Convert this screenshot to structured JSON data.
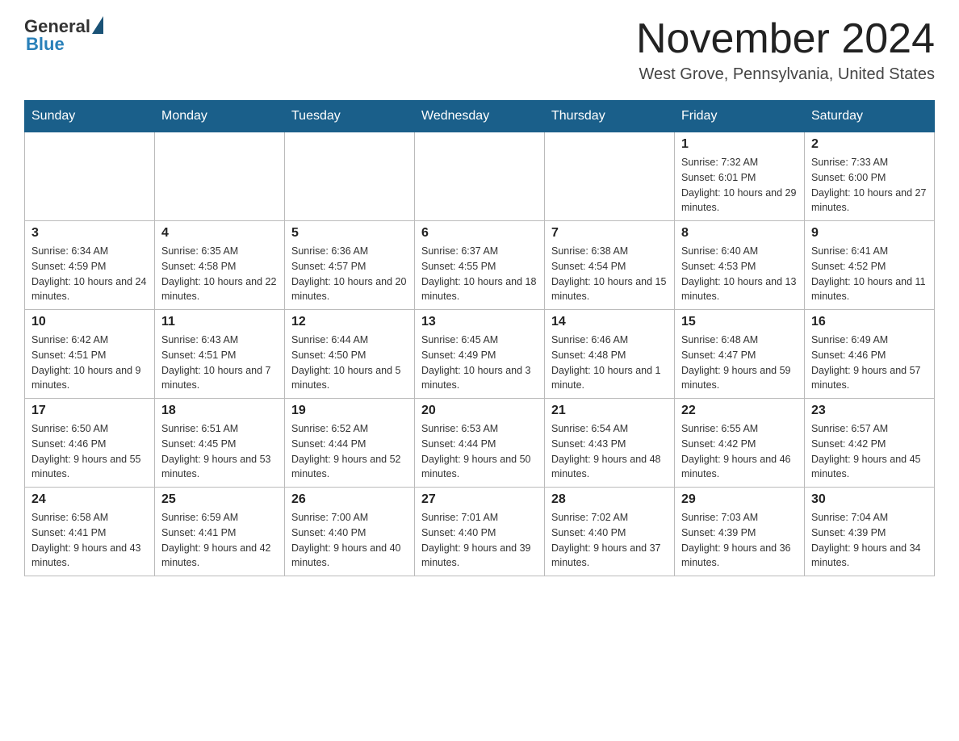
{
  "header": {
    "logo_general": "General",
    "logo_blue": "Blue",
    "month_title": "November 2024",
    "location": "West Grove, Pennsylvania, United States"
  },
  "weekdays": [
    "Sunday",
    "Monday",
    "Tuesday",
    "Wednesday",
    "Thursday",
    "Friday",
    "Saturday"
  ],
  "rows": [
    {
      "cells": [
        {
          "day": null,
          "sunrise": null,
          "sunset": null,
          "daylight": null
        },
        {
          "day": null,
          "sunrise": null,
          "sunset": null,
          "daylight": null
        },
        {
          "day": null,
          "sunrise": null,
          "sunset": null,
          "daylight": null
        },
        {
          "day": null,
          "sunrise": null,
          "sunset": null,
          "daylight": null
        },
        {
          "day": null,
          "sunrise": null,
          "sunset": null,
          "daylight": null
        },
        {
          "day": "1",
          "sunrise": "Sunrise: 7:32 AM",
          "sunset": "Sunset: 6:01 PM",
          "daylight": "Daylight: 10 hours and 29 minutes."
        },
        {
          "day": "2",
          "sunrise": "Sunrise: 7:33 AM",
          "sunset": "Sunset: 6:00 PM",
          "daylight": "Daylight: 10 hours and 27 minutes."
        }
      ]
    },
    {
      "cells": [
        {
          "day": "3",
          "sunrise": "Sunrise: 6:34 AM",
          "sunset": "Sunset: 4:59 PM",
          "daylight": "Daylight: 10 hours and 24 minutes."
        },
        {
          "day": "4",
          "sunrise": "Sunrise: 6:35 AM",
          "sunset": "Sunset: 4:58 PM",
          "daylight": "Daylight: 10 hours and 22 minutes."
        },
        {
          "day": "5",
          "sunrise": "Sunrise: 6:36 AM",
          "sunset": "Sunset: 4:57 PM",
          "daylight": "Daylight: 10 hours and 20 minutes."
        },
        {
          "day": "6",
          "sunrise": "Sunrise: 6:37 AM",
          "sunset": "Sunset: 4:55 PM",
          "daylight": "Daylight: 10 hours and 18 minutes."
        },
        {
          "day": "7",
          "sunrise": "Sunrise: 6:38 AM",
          "sunset": "Sunset: 4:54 PM",
          "daylight": "Daylight: 10 hours and 15 minutes."
        },
        {
          "day": "8",
          "sunrise": "Sunrise: 6:40 AM",
          "sunset": "Sunset: 4:53 PM",
          "daylight": "Daylight: 10 hours and 13 minutes."
        },
        {
          "day": "9",
          "sunrise": "Sunrise: 6:41 AM",
          "sunset": "Sunset: 4:52 PM",
          "daylight": "Daylight: 10 hours and 11 minutes."
        }
      ]
    },
    {
      "cells": [
        {
          "day": "10",
          "sunrise": "Sunrise: 6:42 AM",
          "sunset": "Sunset: 4:51 PM",
          "daylight": "Daylight: 10 hours and 9 minutes."
        },
        {
          "day": "11",
          "sunrise": "Sunrise: 6:43 AM",
          "sunset": "Sunset: 4:51 PM",
          "daylight": "Daylight: 10 hours and 7 minutes."
        },
        {
          "day": "12",
          "sunrise": "Sunrise: 6:44 AM",
          "sunset": "Sunset: 4:50 PM",
          "daylight": "Daylight: 10 hours and 5 minutes."
        },
        {
          "day": "13",
          "sunrise": "Sunrise: 6:45 AM",
          "sunset": "Sunset: 4:49 PM",
          "daylight": "Daylight: 10 hours and 3 minutes."
        },
        {
          "day": "14",
          "sunrise": "Sunrise: 6:46 AM",
          "sunset": "Sunset: 4:48 PM",
          "daylight": "Daylight: 10 hours and 1 minute."
        },
        {
          "day": "15",
          "sunrise": "Sunrise: 6:48 AM",
          "sunset": "Sunset: 4:47 PM",
          "daylight": "Daylight: 9 hours and 59 minutes."
        },
        {
          "day": "16",
          "sunrise": "Sunrise: 6:49 AM",
          "sunset": "Sunset: 4:46 PM",
          "daylight": "Daylight: 9 hours and 57 minutes."
        }
      ]
    },
    {
      "cells": [
        {
          "day": "17",
          "sunrise": "Sunrise: 6:50 AM",
          "sunset": "Sunset: 4:46 PM",
          "daylight": "Daylight: 9 hours and 55 minutes."
        },
        {
          "day": "18",
          "sunrise": "Sunrise: 6:51 AM",
          "sunset": "Sunset: 4:45 PM",
          "daylight": "Daylight: 9 hours and 53 minutes."
        },
        {
          "day": "19",
          "sunrise": "Sunrise: 6:52 AM",
          "sunset": "Sunset: 4:44 PM",
          "daylight": "Daylight: 9 hours and 52 minutes."
        },
        {
          "day": "20",
          "sunrise": "Sunrise: 6:53 AM",
          "sunset": "Sunset: 4:44 PM",
          "daylight": "Daylight: 9 hours and 50 minutes."
        },
        {
          "day": "21",
          "sunrise": "Sunrise: 6:54 AM",
          "sunset": "Sunset: 4:43 PM",
          "daylight": "Daylight: 9 hours and 48 minutes."
        },
        {
          "day": "22",
          "sunrise": "Sunrise: 6:55 AM",
          "sunset": "Sunset: 4:42 PM",
          "daylight": "Daylight: 9 hours and 46 minutes."
        },
        {
          "day": "23",
          "sunrise": "Sunrise: 6:57 AM",
          "sunset": "Sunset: 4:42 PM",
          "daylight": "Daylight: 9 hours and 45 minutes."
        }
      ]
    },
    {
      "cells": [
        {
          "day": "24",
          "sunrise": "Sunrise: 6:58 AM",
          "sunset": "Sunset: 4:41 PM",
          "daylight": "Daylight: 9 hours and 43 minutes."
        },
        {
          "day": "25",
          "sunrise": "Sunrise: 6:59 AM",
          "sunset": "Sunset: 4:41 PM",
          "daylight": "Daylight: 9 hours and 42 minutes."
        },
        {
          "day": "26",
          "sunrise": "Sunrise: 7:00 AM",
          "sunset": "Sunset: 4:40 PM",
          "daylight": "Daylight: 9 hours and 40 minutes."
        },
        {
          "day": "27",
          "sunrise": "Sunrise: 7:01 AM",
          "sunset": "Sunset: 4:40 PM",
          "daylight": "Daylight: 9 hours and 39 minutes."
        },
        {
          "day": "28",
          "sunrise": "Sunrise: 7:02 AM",
          "sunset": "Sunset: 4:40 PM",
          "daylight": "Daylight: 9 hours and 37 minutes."
        },
        {
          "day": "29",
          "sunrise": "Sunrise: 7:03 AM",
          "sunset": "Sunset: 4:39 PM",
          "daylight": "Daylight: 9 hours and 36 minutes."
        },
        {
          "day": "30",
          "sunrise": "Sunrise: 7:04 AM",
          "sunset": "Sunset: 4:39 PM",
          "daylight": "Daylight: 9 hours and 34 minutes."
        }
      ]
    }
  ]
}
